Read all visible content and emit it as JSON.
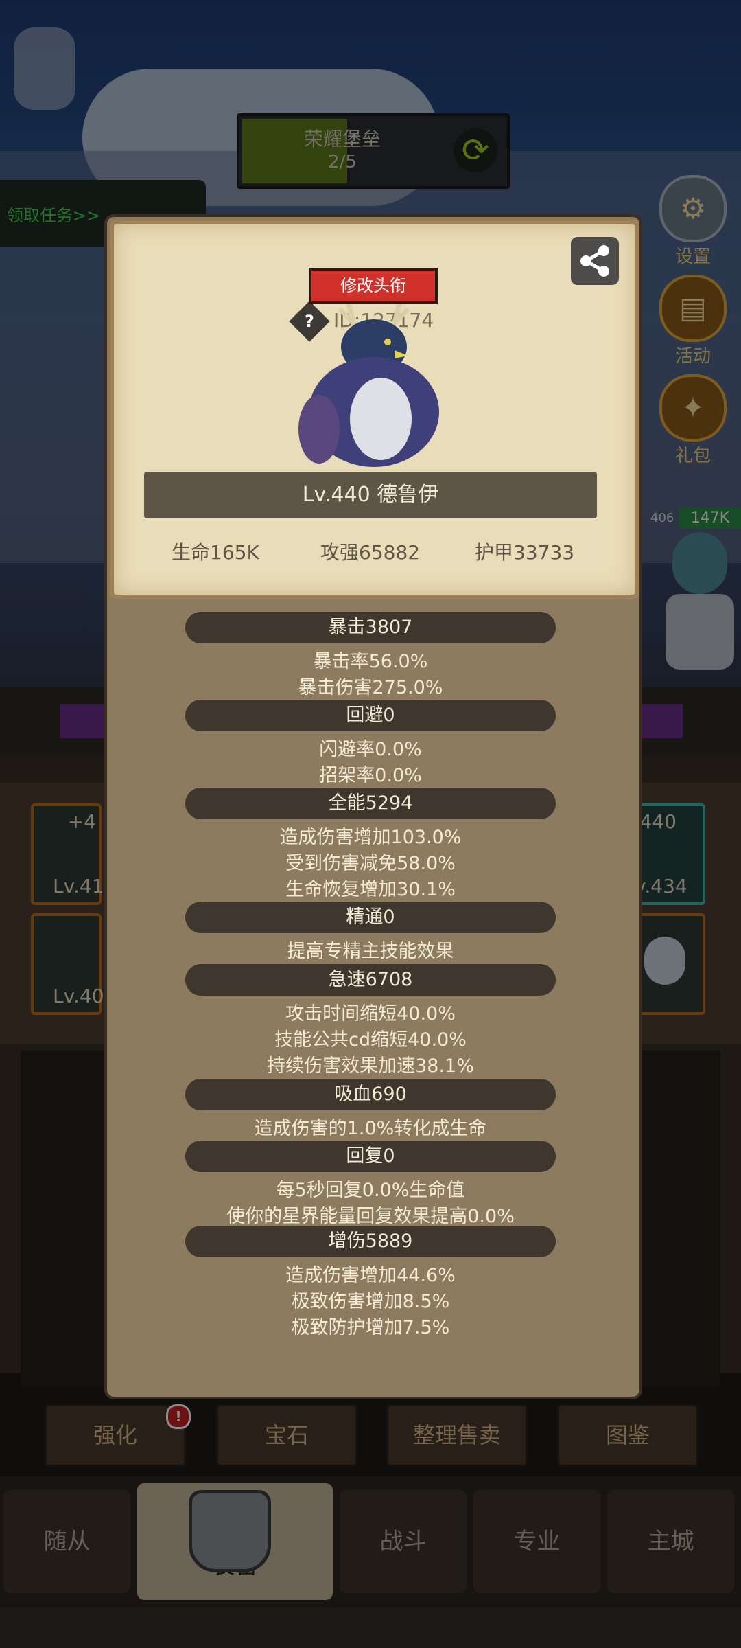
{
  "header": {
    "title": "荣耀堡垒",
    "progress": "2/5",
    "progress_fraction": 0.4
  },
  "task_button": "领取任务>>",
  "side_menu": {
    "settings": "设置",
    "activity": "活动",
    "gift": "礼包"
  },
  "hero_right": {
    "level": "406",
    "hp": "147K"
  },
  "equip_slots": {
    "slot1_plus": "+4",
    "slot1_level": "Lv.41",
    "slot2_level": "Lv.40",
    "slot3_plus": "+440",
    "slot3_level": "v.434"
  },
  "action_buttons": [
    "强化",
    "宝石",
    "整理售卖",
    "图鉴"
  ],
  "nav": {
    "tabs": [
      "随从",
      "装备",
      "战斗",
      "专业",
      "主城"
    ],
    "active": "装备"
  },
  "modal": {
    "title_button": "修改头衔",
    "id_text": "ID:127174",
    "name_bar": "Lv.440 德鲁伊",
    "stats": {
      "hp": "生命165K",
      "attack": "攻强65882",
      "armor": "护甲33733"
    },
    "sections": [
      {
        "header": "暴击3807",
        "lines": [
          "暴击率56.0%",
          "暴击伤害275.0%"
        ]
      },
      {
        "header": "回避0",
        "lines": [
          "闪避率0.0%",
          "招架率0.0%"
        ]
      },
      {
        "header": "全能5294",
        "lines": [
          "造成伤害增加103.0%",
          "受到伤害减免58.0%",
          "生命恢复增加30.1%"
        ]
      },
      {
        "header": "精通0",
        "lines": [
          "提高专精主技能效果"
        ]
      },
      {
        "header": "急速6708",
        "lines": [
          "攻击时间缩短40.0%",
          "技能公共cd缩短40.0%",
          "持续伤害效果加速38.1%"
        ]
      },
      {
        "header": "吸血690",
        "lines": [
          "造成伤害的1.0%转化成生命"
        ]
      },
      {
        "header": "回复0",
        "lines": [
          "每5秒回复0.0%生命值",
          "使你的星界能量回复效果提高0.0%"
        ]
      },
      {
        "header": "增伤5889",
        "lines": [
          "造成伤害增加44.6%",
          "极致伤害增加8.5%",
          "极致防护增加7.5%"
        ]
      }
    ]
  }
}
